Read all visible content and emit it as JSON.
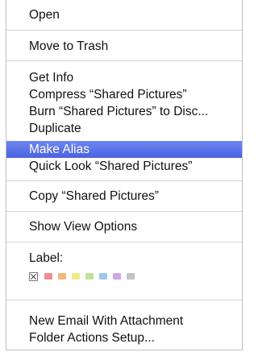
{
  "menu": {
    "items": [
      {
        "label": "Open"
      },
      {
        "label": "Move to Trash"
      },
      {
        "label": "Get Info"
      },
      {
        "label": "Compress “Shared Pictures”"
      },
      {
        "label": "Burn “Shared Pictures” to Disc..."
      },
      {
        "label": "Duplicate"
      },
      {
        "label": "Make Alias",
        "highlighted": true
      },
      {
        "label": "Quick Look “Shared Pictures”"
      },
      {
        "label": "Copy “Shared Pictures”"
      },
      {
        "label": "Show View Options"
      },
      {
        "label": "New Email With Attachment"
      },
      {
        "label": "Folder Actions Setup..."
      }
    ],
    "label_section": {
      "heading": "Label:",
      "swatches": [
        {
          "name": "none",
          "color": "#ffffff"
        },
        {
          "name": "red",
          "color": "#f08d8d"
        },
        {
          "name": "orange",
          "color": "#f2b97a"
        },
        {
          "name": "yellow",
          "color": "#ecec86"
        },
        {
          "name": "green",
          "color": "#bce39a"
        },
        {
          "name": "blue",
          "color": "#9fc6f0"
        },
        {
          "name": "purple",
          "color": "#cfa6e8"
        },
        {
          "name": "gray",
          "color": "#c4c4c4"
        }
      ]
    },
    "highlight_color": "#5a72e8"
  }
}
